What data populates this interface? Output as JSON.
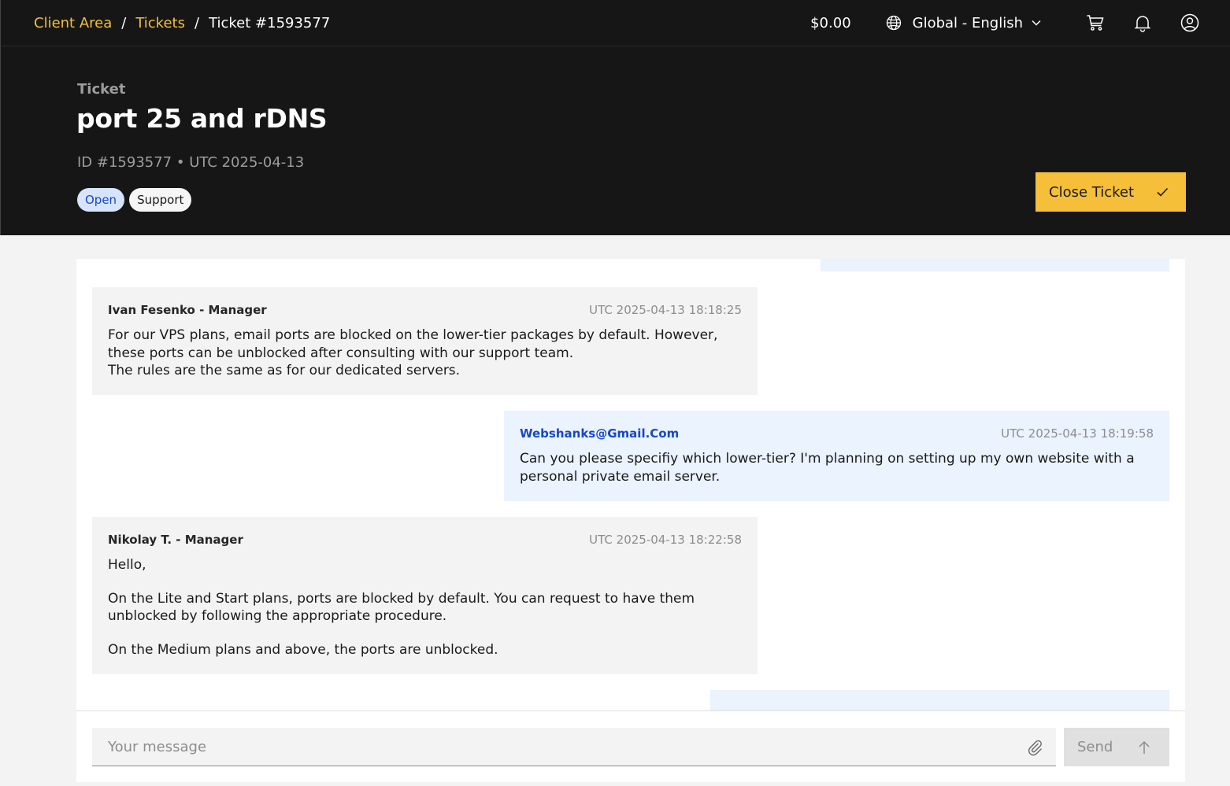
{
  "breadcrumb": {
    "client_area": "Client Area",
    "tickets": "Tickets",
    "current": "Ticket #1593577",
    "separator": "/"
  },
  "topbar": {
    "balance": "$0.00",
    "language": "Global - English",
    "icons": [
      "globe-icon",
      "chevron-down-icon",
      "cart-icon",
      "bell-icon",
      "user-icon"
    ]
  },
  "ticket": {
    "eyebrow": "Ticket",
    "title": "port 25 and rDNS",
    "meta": "ID #1593577 • UTC 2025-04-13",
    "status": "Open",
    "category": "Support",
    "close_label": "Close Ticket"
  },
  "messages": [
    {
      "author": "Ivan Fesenko - Manager",
      "time": "UTC 2025-04-13 18:18:25",
      "side": "staff",
      "paragraphs": [
        "For our VPS plans, email ports are blocked on the lower-tier packages by default. However, these ports can be unblocked after consulting with our support team.",
        "The rules are the same as for our dedicated servers."
      ]
    },
    {
      "author": "Webshanks@Gmail.Com",
      "time": "UTC 2025-04-13 18:19:58",
      "side": "user",
      "paragraphs": [
        "Can you please specifiy which lower-tier? I'm planning on setting up my own website with a personal private email server."
      ]
    },
    {
      "author": "Nikolay T. - Manager",
      "time": "UTC 2025-04-13 18:22:58",
      "side": "staff",
      "paragraphs": [
        "Hello,",
        "On the Lite and Start plans, ports are blocked by default. You can request to have them unblocked by following the appropriate procedure.",
        "On the Medium plans and above, the ports are unblocked."
      ]
    }
  ],
  "composer": {
    "placeholder": "Your message",
    "send_label": "Send"
  },
  "colors": {
    "accent": "#f5bf3a",
    "dark": "#161616",
    "staff_bubble": "#f3f3f3",
    "user_bubble": "#eaf3fe",
    "link_blue": "#1747c7"
  }
}
